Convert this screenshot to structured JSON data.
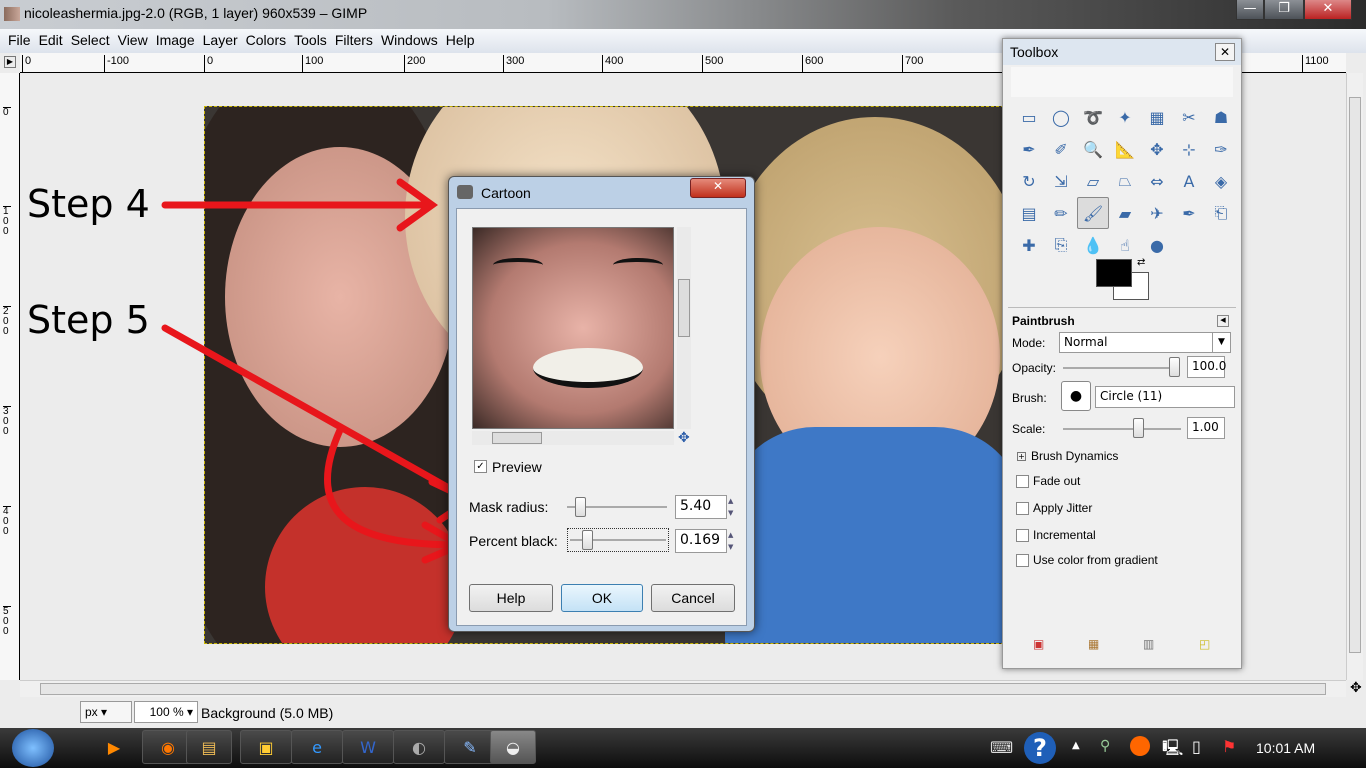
{
  "window": {
    "title": "nicoleashermia.jpg-2.0 (RGB, 1 layer) 960x539 – GIMP",
    "minimize": "—",
    "maximize": "❐",
    "close": "✕"
  },
  "menu": [
    "File",
    "Edit",
    "Select",
    "View",
    "Image",
    "Layer",
    "Colors",
    "Tools",
    "Filters",
    "Windows",
    "Help"
  ],
  "ruler": {
    "h_ticks": [
      "0",
      "-100",
      "0",
      "100",
      "200",
      "300",
      "400",
      "500",
      "600",
      "700",
      "1100"
    ],
    "v_ticks": [
      "0",
      "100",
      "200",
      "300",
      "400",
      "500"
    ]
  },
  "annotations": {
    "step4": "Step 4",
    "step5": "Step 5",
    "arrow_color": "#e8161b"
  },
  "dialog": {
    "title": "Cartoon",
    "close": "✕",
    "preview_label": "Preview",
    "preview_checked": true,
    "mask_radius_label": "Mask radius:",
    "mask_radius_value": "5.40",
    "percent_black_label": "Percent black:",
    "percent_black_value": "0.169",
    "buttons": {
      "help": "Help",
      "ok": "OK",
      "cancel": "Cancel"
    }
  },
  "toolbox": {
    "title": "Toolbox",
    "close": "✕",
    "tools": [
      "rect-select",
      "ellipse-select",
      "free-select",
      "fuzzy-select",
      "color-select",
      "scissors",
      "foreground-select",
      "paths",
      "color-picker",
      "zoom",
      "measure",
      "move",
      "align",
      "crop",
      "rotate",
      "scale",
      "shear",
      "perspective",
      "flip",
      "text",
      "bucket-fill",
      "blend",
      "pencil",
      "paintbrush",
      "eraser",
      "airbrush",
      "ink",
      "clone",
      "heal",
      "perspective-clone",
      "blur",
      "smudge",
      "dodge-burn"
    ],
    "active_tool": "paintbrush",
    "fg_color": "#000000",
    "bg_color": "#ffffff"
  },
  "tool_options": {
    "title": "Paintbrush",
    "mode_label": "Mode:",
    "mode_value": "Normal",
    "opacity_label": "Opacity:",
    "opacity_value": "100.0",
    "brush_label": "Brush:",
    "brush_value": "Circle (11)",
    "scale_label": "Scale:",
    "scale_value": "1.00",
    "brush_dynamics": "Brush Dynamics",
    "checkboxes": [
      {
        "label": "Fade out",
        "checked": false
      },
      {
        "label": "Apply Jitter",
        "checked": false
      },
      {
        "label": "Incremental",
        "checked": false
      },
      {
        "label": "Use color from gradient",
        "checked": false
      }
    ]
  },
  "status": {
    "unit": "px",
    "zoom": "100 %",
    "message": "Background (5.0 MB)"
  },
  "taskbar": {
    "clock": "10:01 AM",
    "apps": [
      "media-player",
      "firefox",
      "explorer",
      "folder",
      "internet-explorer",
      "word",
      "gimp-wilber-dark",
      "paint",
      "gimp"
    ]
  }
}
